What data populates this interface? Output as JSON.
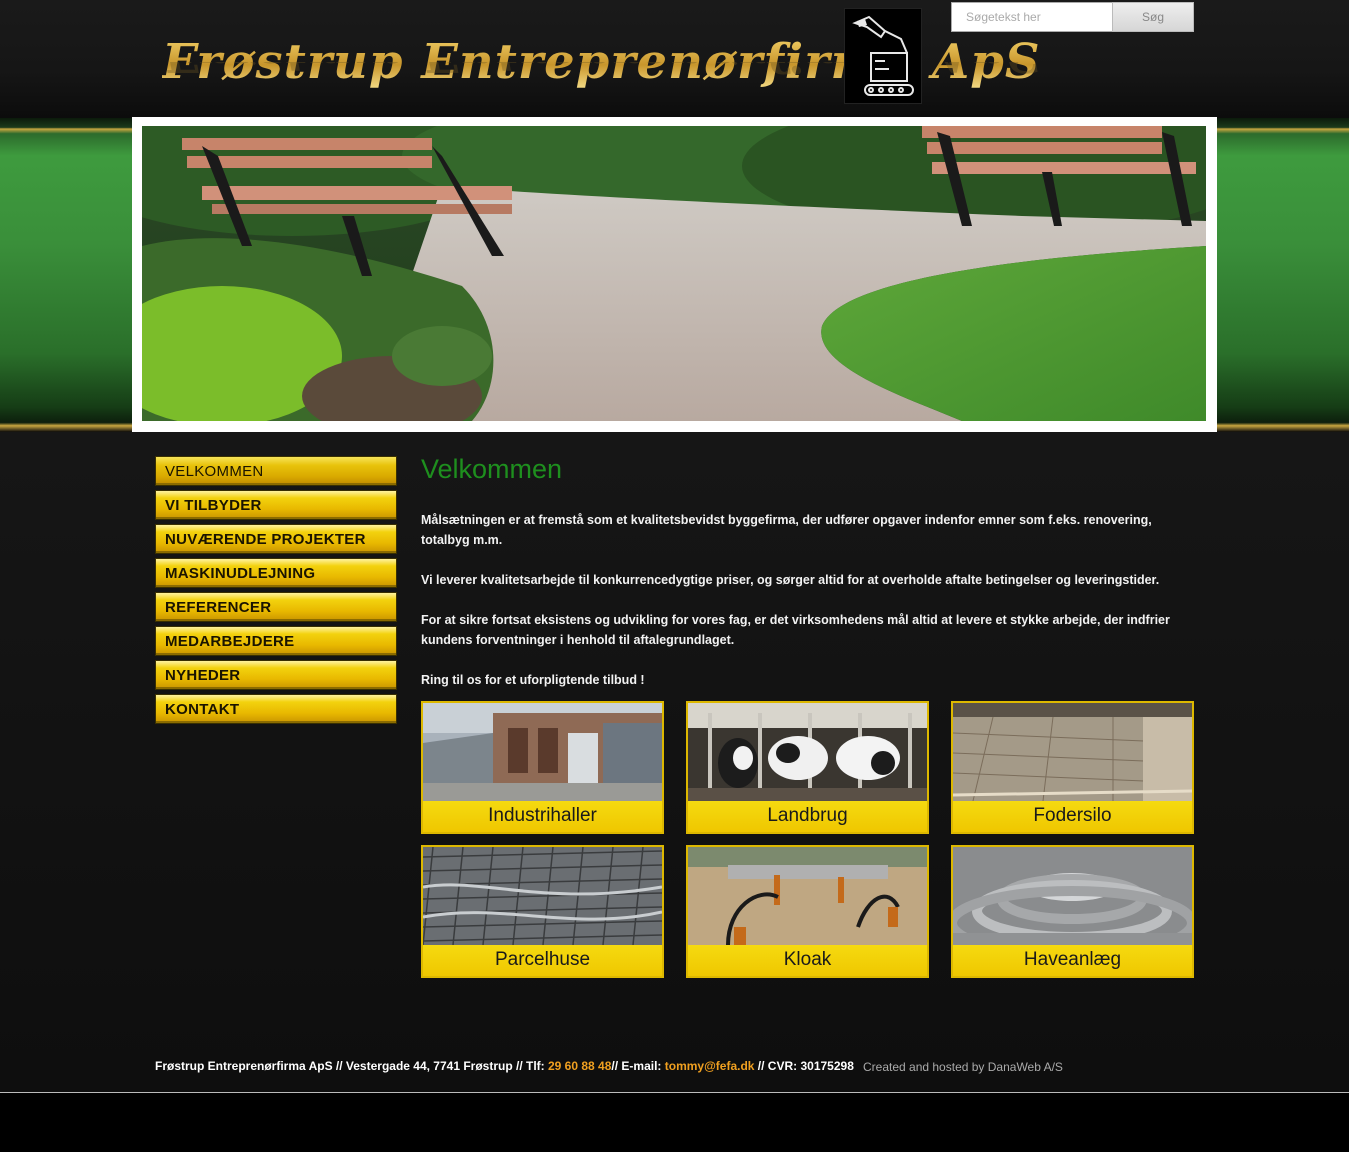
{
  "header": {
    "logo_text": "Frøstrup Entreprenørfirma ApS",
    "search_placeholder": "Søgetekst her",
    "search_button": "Søg"
  },
  "nav": {
    "items": [
      {
        "label": "VELKOMMEN"
      },
      {
        "label": "VI TILBYDER"
      },
      {
        "label": "NUVÆRENDE PROJEKTER"
      },
      {
        "label": "MASKINUDLEJNING"
      },
      {
        "label": "REFERENCER"
      },
      {
        "label": "MEDARBEJDERE"
      },
      {
        "label": "NYHEDER"
      },
      {
        "label": "KONTAKT"
      }
    ]
  },
  "main": {
    "title": "Velkommen",
    "paragraphs": [
      "Målsætningen er at fremstå som et kvalitetsbevidst byggefirma, der udfører opgaver indenfor emner som f.eks. renovering, totalbyg m.m.",
      "Vi leverer kvalitetsarbejde til konkurrencedygtige priser, og sørger altid for at overholde aftalte betingelser og leveringstider.",
      "For at sikre fortsat eksistens og udvikling for vores fag, er det virksomhedens mål altid at levere et stykke arbejde, der indfrier kundens forventninger i henhold til aftalegrundlaget.",
      "Ring til os for et uforpligtende tilbud !"
    ],
    "tiles": [
      {
        "label": "Industrihaller"
      },
      {
        "label": "Landbrug"
      },
      {
        "label": "Fodersilo"
      },
      {
        "label": "Parcelhuse"
      },
      {
        "label": "Kloak"
      },
      {
        "label": "Haveanlæg"
      }
    ]
  },
  "footer": {
    "company": "Frøstrup Entreprenørfirma ApS",
    "address": " // Vestergade 44, 7741 Frøstrup // Tlf: ",
    "phone": "29 60 88 48",
    "email_label": "// E-mail: ",
    "email": "tommy@fefa.dk",
    "cvr": " // CVR: 30175298",
    "credit": "Created and hosted by DanaWeb A/S"
  },
  "colors": {
    "accent_yellow": "#f0d000",
    "title_green": "#1e8f1e",
    "footer_accent": "#f0a020"
  }
}
